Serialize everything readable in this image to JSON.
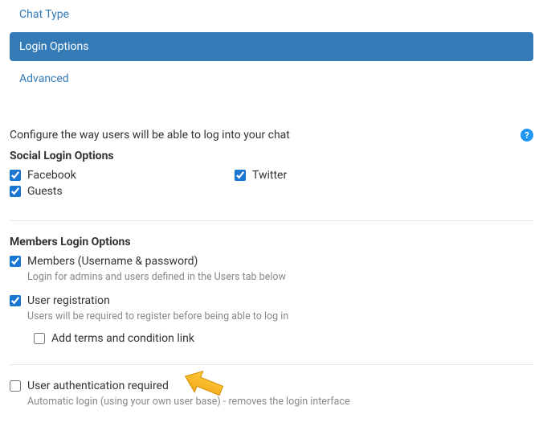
{
  "tabs": {
    "chat_type": "Chat Type",
    "login_options": "Login Options",
    "advanced": "Advanced"
  },
  "config_intro": "Configure the way users will be able to log into your chat",
  "help_icon": "?",
  "social": {
    "title": "Social Login Options",
    "facebook": "Facebook",
    "twitter": "Twitter",
    "guests": "Guests"
  },
  "members": {
    "title": "Members Login Options",
    "members_label": "Members (Username & password)",
    "members_desc": "Login for admins and users defined in the Users tab below",
    "registration_label": "User registration",
    "registration_desc": "Users will be required to register before being able to log in",
    "terms_label": "Add terms and condition link",
    "auth_label": "User authentication required",
    "auth_desc": "Automatic login (using your own user base) - removes the login interface"
  }
}
